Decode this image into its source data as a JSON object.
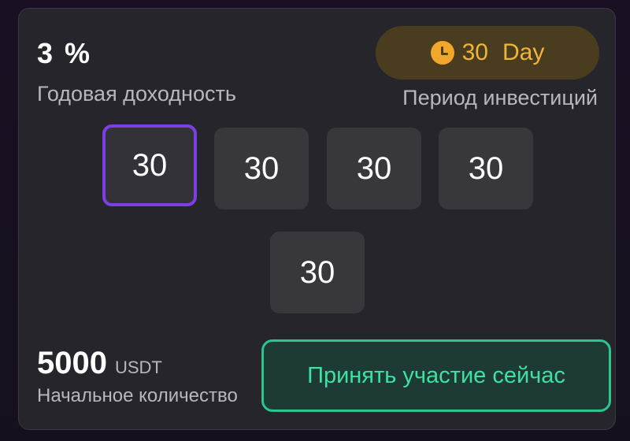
{
  "rate": {
    "value": "3",
    "unit": "%",
    "label": "Годовая доходность"
  },
  "period": {
    "value": "30",
    "unit": "Day",
    "label": "Период инвестиций",
    "icon": "clock-icon"
  },
  "options": [
    "30",
    "30",
    "30",
    "30",
    "30"
  ],
  "selected_index": 0,
  "amount": {
    "value": "5000",
    "unit": "USDT",
    "label": "Начальное количество"
  },
  "cta": {
    "label": "Принять участие сейчас"
  },
  "colors": {
    "accent_purple": "#7b3fe4",
    "accent_green": "#2cc590",
    "accent_gold": "#f1b43a"
  }
}
